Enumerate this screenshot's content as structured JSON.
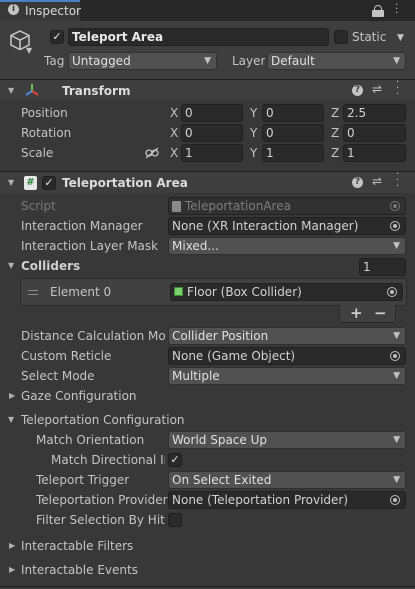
{
  "tab": {
    "title": "Inspector"
  },
  "object": {
    "active": true,
    "name": "Teleport Area",
    "static_label": "Static",
    "static": false,
    "tag_label": "Tag",
    "tag_value": "Untagged",
    "layer_label": "Layer",
    "layer_value": "Default"
  },
  "transform": {
    "title": "Transform",
    "rows": [
      {
        "label": "Position",
        "x": "0",
        "y": "0",
        "z": "2.5"
      },
      {
        "label": "Rotation",
        "x": "0",
        "y": "0",
        "z": "0"
      },
      {
        "label": "Scale",
        "x": "1",
        "y": "1",
        "z": "1"
      }
    ],
    "axis_x": "X",
    "axis_y": "Y",
    "axis_z": "Z"
  },
  "teleportation": {
    "title": "Teleportation Area",
    "enabled": true,
    "script_label": "Script",
    "script_value": "TeleportationArea",
    "interaction_manager_label": "Interaction Manager",
    "interaction_manager_value": "None (XR Interaction Manager)",
    "layer_mask_label": "Interaction Layer Mask",
    "layer_mask_value": "Mixed...",
    "colliders_label": "Colliders",
    "colliders_count": "1",
    "element_label": "Element 0",
    "element_value": "Floor (Box Collider)",
    "plus": "+",
    "minus": "−",
    "distance_label": "Distance Calculation Mod",
    "distance_value": "Collider Position",
    "reticle_label": "Custom Reticle",
    "reticle_value": "None (Game Object)",
    "select_mode_label": "Select Mode",
    "select_mode_value": "Multiple",
    "gaze_label": "Gaze Configuration",
    "tp_config_label": "Teleportation Configuration",
    "match_orientation_label": "Match Orientation",
    "match_orientation_value": "World Space Up",
    "match_directional_label": "Match Directional In",
    "match_directional": true,
    "trigger_label": "Teleport Trigger",
    "trigger_value": "On Select Exited",
    "provider_label": "Teleportation Provider",
    "provider_value": "None (Teleportation Provider)",
    "filter_label": "Filter Selection By Hit N",
    "filter": false,
    "filters_label": "Interactable Filters",
    "events_label": "Interactable Events"
  }
}
